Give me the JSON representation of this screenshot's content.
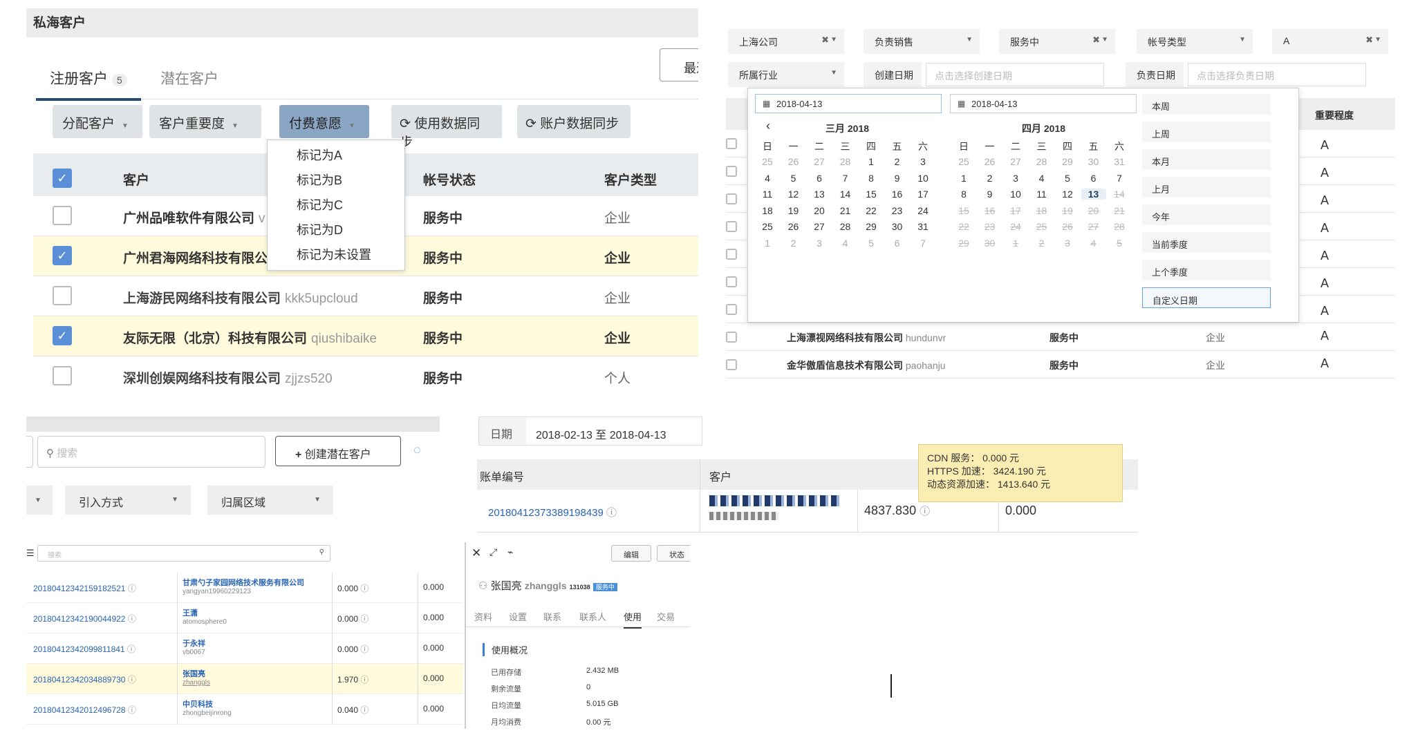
{
  "p1": {
    "title": "私海客户",
    "tabs": [
      {
        "label": "注册客户",
        "badge": "5"
      },
      {
        "label": "潜在客户"
      }
    ],
    "top_right_btn": "最近",
    "buttons": [
      "分配客户",
      "客户重要度",
      "付费意愿",
      "使用数据同步",
      "账户数据同步"
    ],
    "dropdown": [
      "标记为A",
      "标记为B",
      "标记为C",
      "标记为D",
      "标记为未设置"
    ],
    "headers": [
      "客户",
      "帐号状态",
      "客户类型"
    ],
    "rows": [
      {
        "name": "广州品唯软件有限公司",
        "sub": "v",
        "status": "服务中",
        "type": "企业",
        "checked": false
      },
      {
        "name": "广州君海网络科技有限公",
        "sub": "",
        "status": "服务中",
        "type": "企业",
        "checked": true
      },
      {
        "name": "上海游民网络科技有限公司",
        "sub": "kkk5upcloud",
        "status": "服务中",
        "type": "企业",
        "checked": false
      },
      {
        "name": "友际无限（北京）科技有限公司",
        "sub": "qiushibaike",
        "status": "服务中",
        "type": "企业",
        "checked": true
      },
      {
        "name": "深圳创娱网络科技有限公司",
        "sub": "zjjzs520",
        "status": "服务中",
        "type": "个人",
        "checked": false
      }
    ]
  },
  "p2": {
    "filters": [
      "上海公司",
      "负责销售",
      "服务中",
      "帐号类型",
      "A"
    ],
    "industry": "所属行业",
    "create_date_label": "创建日期",
    "create_date_placeholder": "点击选择创建日期",
    "owner_date_label": "负责日期",
    "owner_date_placeholder": "点击选择负责日期",
    "col_importance": "重要程度",
    "date_from": "2018-04-13",
    "date_to": "2018-04-13",
    "month1": "三月 2018",
    "month2": "四月 2018",
    "weekdays": [
      "日",
      "一",
      "二",
      "三",
      "四",
      "五",
      "六"
    ],
    "quick": [
      "本周",
      "上周",
      "本月",
      "上月",
      "今年",
      "当前季度",
      "上个季度",
      "自定义日期"
    ],
    "importance": [
      "A",
      "A",
      "A",
      "A",
      "A",
      "A",
      "A",
      "A",
      "A"
    ],
    "rows": [
      {
        "name": "上海漂视网络科技有限公司",
        "sub": "hundunvr",
        "status": "服务中",
        "type": "企业",
        "imp": "A"
      },
      {
        "name": "金华傲盾信息技术有限公司",
        "sub": "paohanju",
        "status": "服务中",
        "type": "企业",
        "imp": "A"
      }
    ]
  },
  "p3": {
    "search_placeholder": "搜索",
    "create_btn": "创建潜在客户",
    "filters": [
      "引入方式",
      "归属区域"
    ]
  },
  "p4": {
    "date_label": "日期",
    "date_value": "2018-02-13 至 2018-04-13",
    "headers": [
      "账单编号",
      "客户"
    ],
    "bill_no": "20180412373389198439",
    "amount": "4837.830",
    "amount2": "0.000",
    "tooltip": [
      "CDN 服务：  0.000 元",
      "HTTPS 加速：  3424.190 元",
      "动态资源加速：  1413.640 元"
    ]
  },
  "p5": {
    "search_placeholder": "搜索",
    "rows": [
      {
        "id": "20180412342159182521",
        "name": "甘肃勺子家园网络技术服务有限公司",
        "sub": "yangyan19960229123",
        "v1": "0.000",
        "v2": "0.000"
      },
      {
        "id": "20180412342190044922",
        "name": "王潇",
        "sub": "atomosphere0",
        "v1": "0.000",
        "v2": "0.000"
      },
      {
        "id": "20180412342099811841",
        "name": "于永祥",
        "sub": "vb0067",
        "v1": "0.000",
        "v2": "0.000"
      },
      {
        "id": "20180412342034889730",
        "name": "张国亮",
        "sub": "zhanggls",
        "v1": "1.970",
        "v2": "0.000"
      },
      {
        "id": "20180412342012496728",
        "name": "中贝科技",
        "sub": "zhongbeijinrong",
        "v1": "0.040",
        "v2": "0.000"
      }
    ],
    "detail": {
      "edit": "编辑",
      "status": "状态",
      "user": "张国亮",
      "user_en": "zhanggls",
      "uid": "131038",
      "badge": "服务中",
      "tabs": [
        "资料",
        "设置",
        "联系",
        "联系人",
        "使用",
        "交易"
      ],
      "section": "使用概况",
      "stats": [
        {
          "k": "已用存储",
          "v": "2.432 MB"
        },
        {
          "k": "剩余流量",
          "v": "0"
        },
        {
          "k": "日均流量",
          "v": "5.015 GB"
        },
        {
          "k": "月均消费",
          "v": "0.00 元"
        }
      ]
    }
  }
}
